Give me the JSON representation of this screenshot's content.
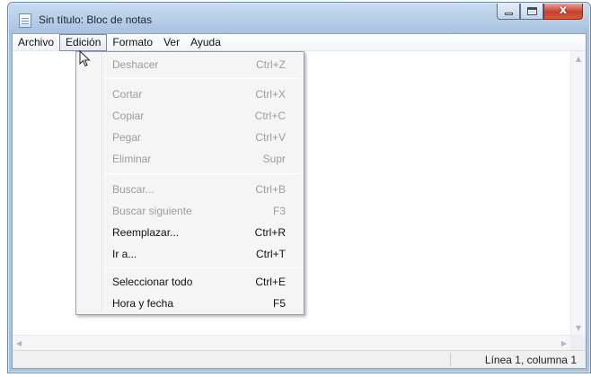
{
  "window": {
    "title": "Sin título: Bloc de notas"
  },
  "title_buttons": {
    "minimize": "minimize-icon",
    "maximize": "maximize-icon",
    "close": "x"
  },
  "menubar": {
    "items": [
      {
        "label": "Archivo"
      },
      {
        "label": "Edición"
      },
      {
        "label": "Formato"
      },
      {
        "label": "Ver"
      },
      {
        "label": "Ayuda"
      }
    ]
  },
  "edit_menu": {
    "items": [
      {
        "label": "Deshacer",
        "shortcut": "Ctrl+Z",
        "enabled": false
      },
      {
        "label": "Cortar",
        "shortcut": "Ctrl+X",
        "enabled": false
      },
      {
        "label": "Copiar",
        "shortcut": "Ctrl+C",
        "enabled": false
      },
      {
        "label": "Pegar",
        "shortcut": "Ctrl+V",
        "enabled": false
      },
      {
        "label": "Eliminar",
        "shortcut": "Supr",
        "enabled": false
      },
      {
        "label": "Buscar...",
        "shortcut": "Ctrl+B",
        "enabled": false
      },
      {
        "label": "Buscar siguiente",
        "shortcut": "F3",
        "enabled": false
      },
      {
        "label": "Reemplazar...",
        "shortcut": "Ctrl+R",
        "enabled": true
      },
      {
        "label": "Ir a...",
        "shortcut": "Ctrl+T",
        "enabled": true
      },
      {
        "label": "Seleccionar todo",
        "shortcut": "Ctrl+E",
        "enabled": true
      },
      {
        "label": "Hora y fecha",
        "shortcut": "F5",
        "enabled": true
      }
    ]
  },
  "status": {
    "position": "Línea 1, columna 1"
  },
  "colors": {
    "title_bar": "#b6cde6",
    "close_button": "#c7402c",
    "disabled_text": "#9c9c9c",
    "menu_bg": "#f5f5f5"
  }
}
